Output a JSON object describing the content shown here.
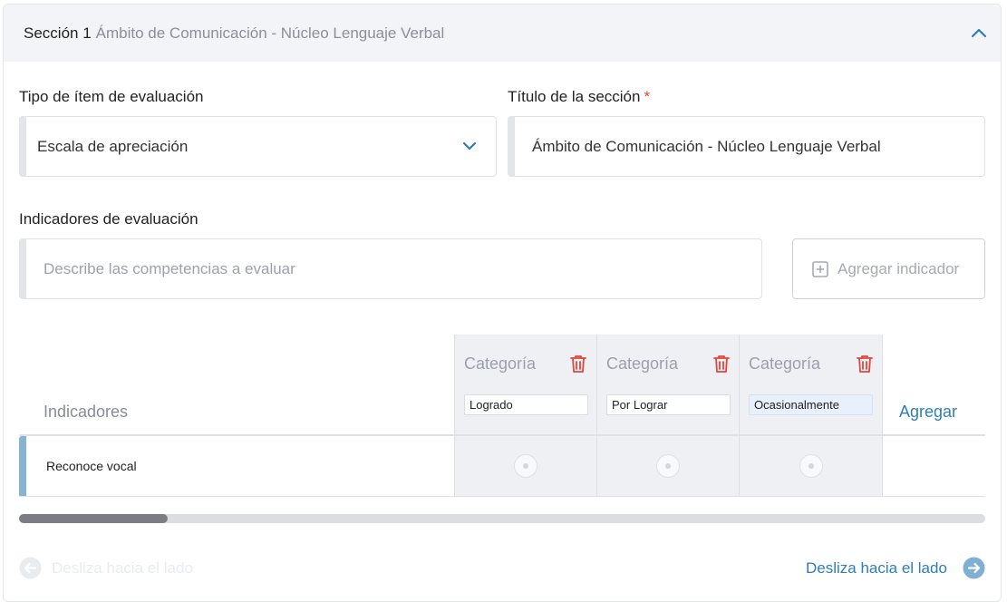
{
  "section": {
    "prefix": "Sección 1",
    "title": "Ámbito de Comunicación - Núcleo Lenguaje Verbal"
  },
  "item_type": {
    "label": "Tipo de ítem de evaluación",
    "value": "Escala de apreciación"
  },
  "section_title": {
    "label": "Título de la sección",
    "required_mark": "*",
    "value": "Ámbito de Comunicación - Núcleo Lenguaje Verbal"
  },
  "indicators": {
    "label": "Indicadores de evaluación",
    "placeholder": "Describe las competencias a evaluar",
    "add_button": "Agregar indicador"
  },
  "table": {
    "indicators_header": "Indicadores",
    "add_column": "Agregar",
    "categories": [
      {
        "label": "Categoría",
        "value": "Logrado"
      },
      {
        "label": "Categoría",
        "value": "Por Lograr"
      },
      {
        "label": "Categoría",
        "value": "Ocasionalmente"
      }
    ],
    "rows": [
      {
        "label": "Reconoce vocal"
      }
    ]
  },
  "nav": {
    "prev": "Desliza hacia el lado",
    "next": "Desliza hacia el lado"
  },
  "colors": {
    "accent": "#2f7fb4",
    "danger": "#e0463b",
    "row_accent": "#86b5d2"
  }
}
